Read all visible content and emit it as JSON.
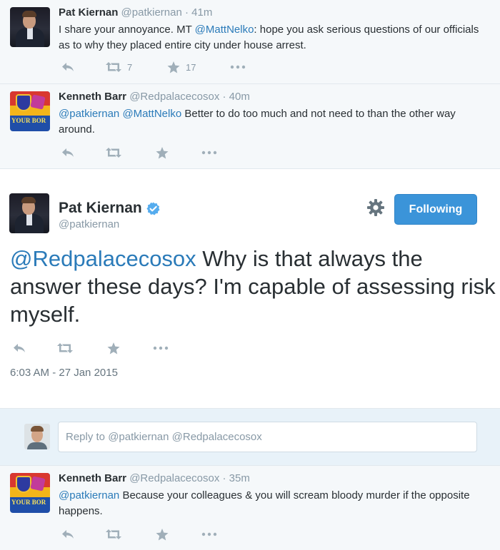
{
  "tweets": [
    {
      "name": "Pat Kiernan",
      "handle": "@patkiernan",
      "time": "· 41m",
      "text_pre": "I share your annoyance. MT ",
      "mention1": "@MattNelko",
      "text_post": ": hope you ask serious questions of our officials as to why they placed entire city under house arrest.",
      "retweets": "7",
      "favorites": "17"
    },
    {
      "name": "Kenneth Barr",
      "handle": "@Redpalacecosox",
      "time": "· 40m",
      "mention1": "@patkiernan",
      "mention2": "@MattNelko",
      "text_post": " Better to do too much and not need to than the other way around.",
      "avatar_text": "YOUR BOR"
    },
    {
      "name": "Kenneth Barr",
      "handle": "@Redpalacecosox",
      "time": "· 35m",
      "mention1": "@patkiernan",
      "text_post": " Because your colleagues & you will scream bloody murder if the opposite happens.",
      "avatar_text": "YOUR BOR"
    }
  ],
  "focused": {
    "name": "Pat Kiernan",
    "handle": "@patkiernan",
    "follow_label": "Following",
    "mention": "@Redpalacecosox",
    "text": " Why is that always the answer these days? I'm capable of assessing risk myself.",
    "timestamp": "6:03 AM - 27 Jan 2015"
  },
  "composer": {
    "placeholder": "Reply to @patkiernan @Redpalacecosox"
  },
  "colors": {
    "link": "#2b7bb9",
    "follow_button": "#3b94d9",
    "verified": "#55acee",
    "muted": "#8899a6"
  },
  "icons": [
    "reply-icon",
    "retweet-icon",
    "favorite-icon",
    "more-icon",
    "verified-icon",
    "gear-icon"
  ]
}
